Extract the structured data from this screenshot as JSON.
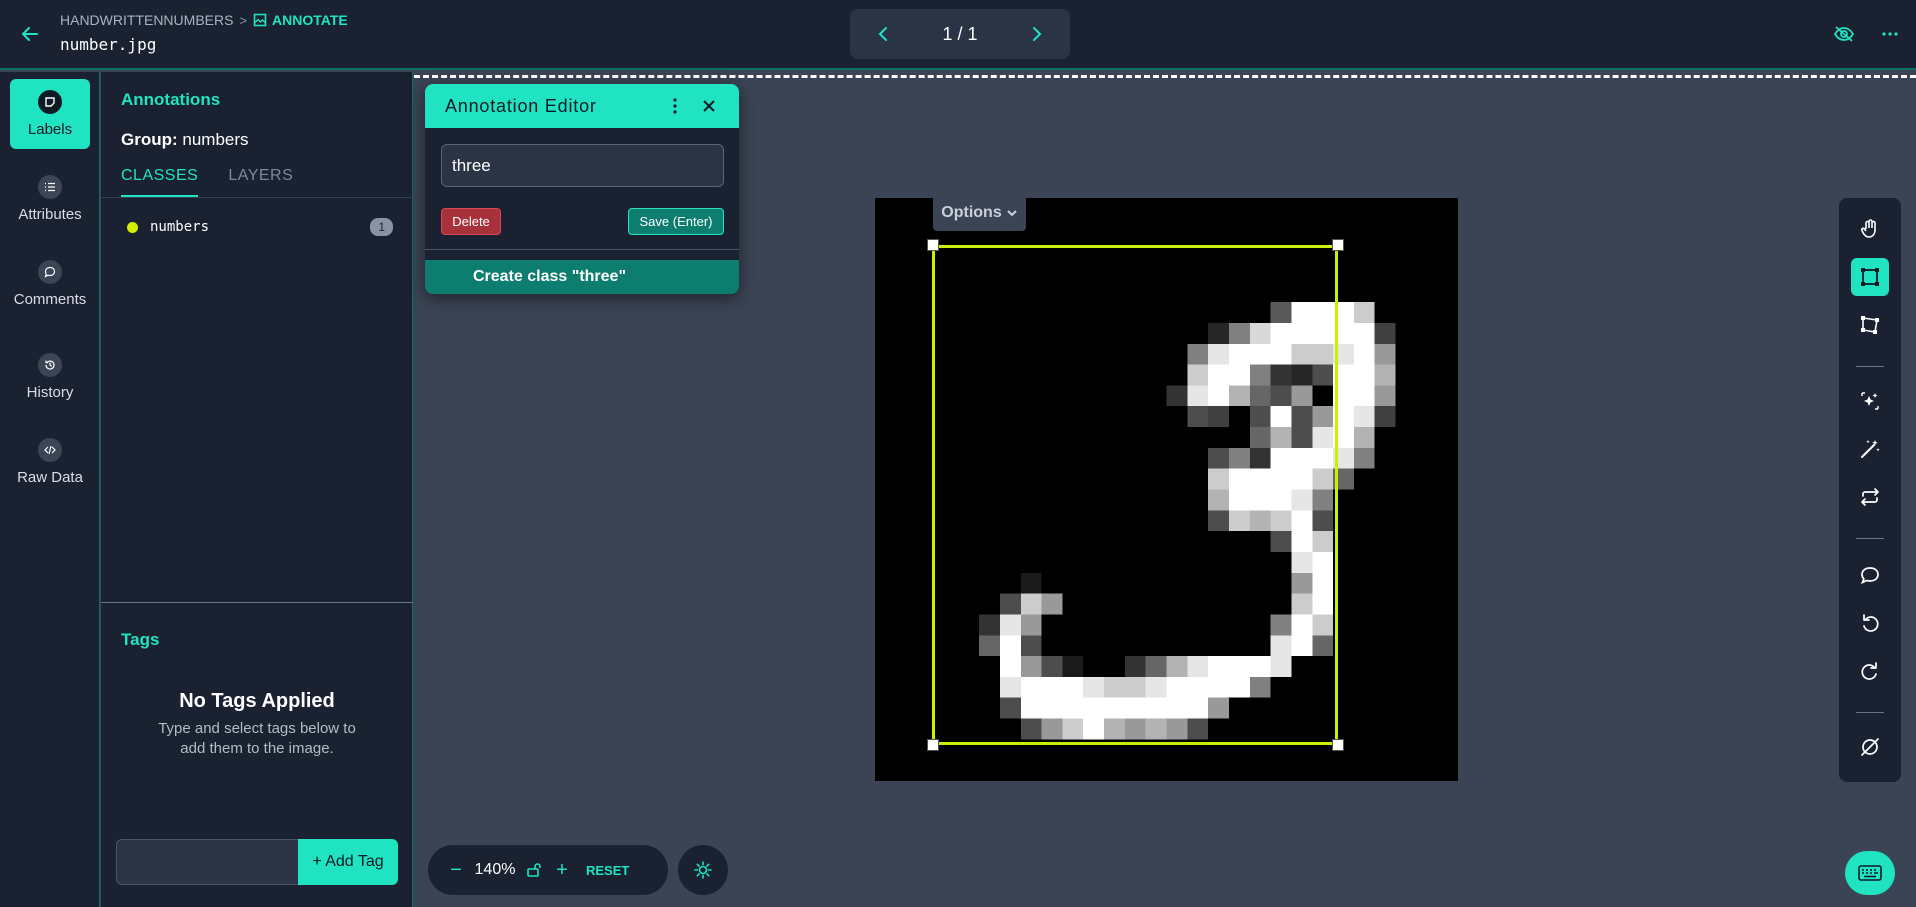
{
  "header": {
    "project": "HANDWRITTENNUMBERS",
    "separator": ">",
    "mode": "ANNOTATE",
    "filename": "number.jpg",
    "pager": "1 / 1"
  },
  "rail": {
    "items": [
      {
        "label": "Labels",
        "icon": "label-icon"
      },
      {
        "label": "Attributes",
        "icon": "list-icon"
      },
      {
        "label": "Comments",
        "icon": "comment-icon"
      },
      {
        "label": "History",
        "icon": "history-icon"
      },
      {
        "label": "Raw Data",
        "icon": "code-icon"
      }
    ]
  },
  "annotations": {
    "title": "Annotations",
    "group_label": "Group:",
    "group_value": "numbers",
    "tabs": [
      "CLASSES",
      "LAYERS"
    ],
    "classes": [
      {
        "name": "numbers",
        "count": "1",
        "color": "#d4f000"
      }
    ]
  },
  "tags": {
    "title": "Tags",
    "empty_title": "No Tags Applied",
    "empty_sub_1": "Type and select tags below to",
    "empty_sub_2": "add them to the image.",
    "add_button": "+ Add Tag",
    "input_value": ""
  },
  "editor": {
    "title": "Annotation Editor",
    "input_value": "three",
    "delete_label": "Delete",
    "save_label": "Save (Enter)",
    "create_label": "Create class \"three\""
  },
  "canvas": {
    "options_label": "Options",
    "bbox_color": "#c8f000"
  },
  "zoom": {
    "minus": "−",
    "value": "140%",
    "plus": "+",
    "reset": "RESET"
  },
  "colors": {
    "accent": "#20e3c2",
    "background": "#3b4454",
    "panel": "#1a2231",
    "danger": "#a8323c"
  }
}
